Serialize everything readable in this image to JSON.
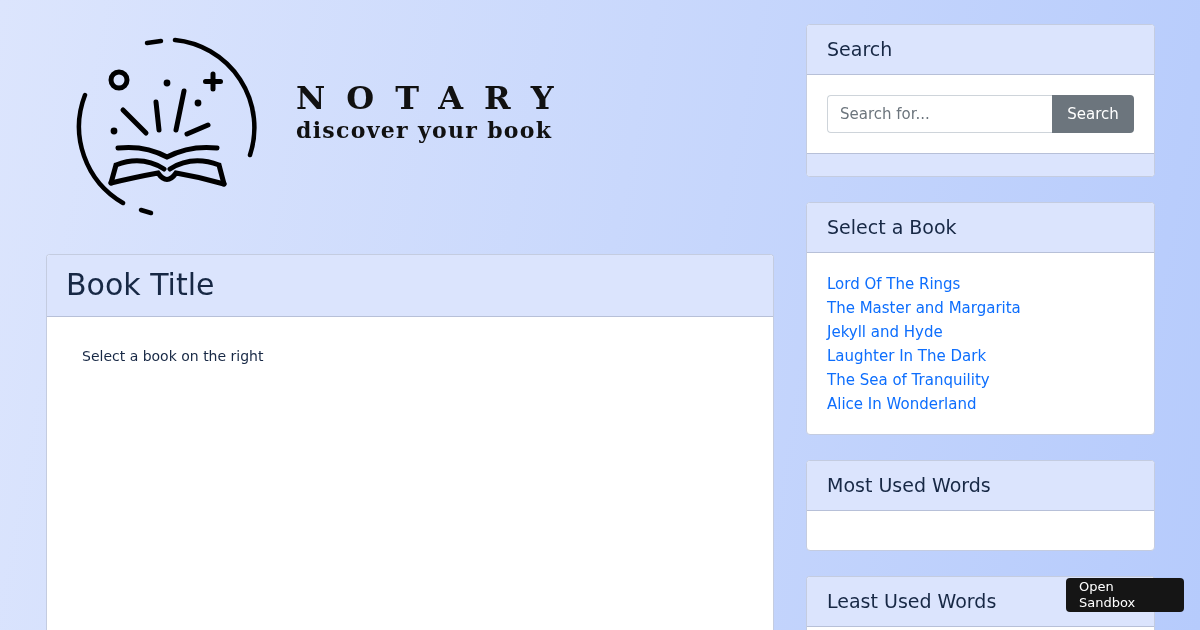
{
  "brand": {
    "name": "NOTARY",
    "tagline": "discover your book"
  },
  "book_panel": {
    "title": "Book Title",
    "message": "Select a book on the right"
  },
  "sidebar": {
    "search": {
      "title": "Search",
      "placeholder": "Search for...",
      "button": "Search"
    },
    "book_list": {
      "title": "Select a Book",
      "books": [
        "Lord Of The Rings",
        "The Master and Margarita",
        "Jekyll and Hyde",
        "Laughter In The Dark",
        "The Sea of Tranquility",
        "Alice In Wonderland"
      ]
    },
    "most_used_words": {
      "title": "Most Used Words"
    },
    "least_used_words": {
      "title": "Least Used Words"
    }
  },
  "sandbox_button": {
    "label": "Open Sandbox"
  }
}
